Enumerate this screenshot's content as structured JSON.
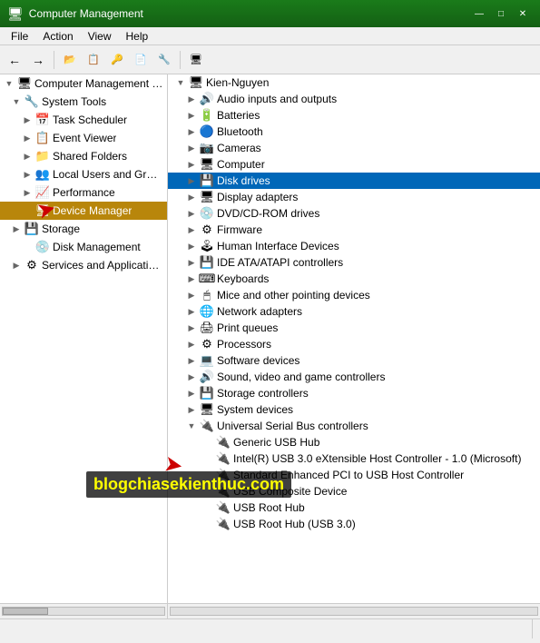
{
  "titlebar": {
    "title": "Computer Management",
    "icon": "🖥",
    "minimize_label": "—",
    "maximize_label": "□",
    "close_label": "✕"
  },
  "menubar": {
    "items": [
      {
        "label": "File"
      },
      {
        "label": "Action"
      },
      {
        "label": "View"
      },
      {
        "label": "Help"
      }
    ]
  },
  "toolbar": {
    "buttons": [
      "←",
      "→",
      "⬆",
      "✂",
      "📋",
      "📄",
      "✖",
      "🔧",
      "📊"
    ]
  },
  "left_panel": {
    "items": [
      {
        "id": "root",
        "label": "Computer Management (Local",
        "icon": "🖥",
        "indent": 0,
        "expand": "▼"
      },
      {
        "id": "system-tools",
        "label": "System Tools",
        "icon": "🔧",
        "indent": 1,
        "expand": "▼"
      },
      {
        "id": "task-scheduler",
        "label": "Task Scheduler",
        "icon": "📅",
        "indent": 2,
        "expand": "▶"
      },
      {
        "id": "event-viewer",
        "label": "Event Viewer",
        "icon": "📋",
        "indent": 2,
        "expand": "▶"
      },
      {
        "id": "shared-folders",
        "label": "Shared Folders",
        "icon": "📁",
        "indent": 2,
        "expand": "▶"
      },
      {
        "id": "local-users",
        "label": "Local Users and Groups",
        "icon": "👥",
        "indent": 2,
        "expand": "▶"
      },
      {
        "id": "performance",
        "label": "Performance",
        "icon": "📈",
        "indent": 2,
        "expand": "▶"
      },
      {
        "id": "device-manager",
        "label": "Device Manager",
        "icon": "🖥",
        "indent": 2,
        "expand": "",
        "selected": true
      },
      {
        "id": "storage",
        "label": "Storage",
        "icon": "💾",
        "indent": 1,
        "expand": "▶"
      },
      {
        "id": "disk-management",
        "label": "Disk Management",
        "icon": "💿",
        "indent": 2,
        "expand": ""
      },
      {
        "id": "services",
        "label": "Services and Applications",
        "icon": "⚙",
        "indent": 1,
        "expand": "▶"
      }
    ]
  },
  "right_panel": {
    "header": "Kien-Nguyen",
    "devices": [
      {
        "label": "Audio inputs and outputs",
        "icon": "🔊",
        "indent": 1,
        "expand": "▶"
      },
      {
        "label": "Batteries",
        "icon": "🔋",
        "indent": 1,
        "expand": "▶"
      },
      {
        "label": "Bluetooth",
        "icon": "🔵",
        "indent": 1,
        "expand": "▶"
      },
      {
        "label": "Cameras",
        "icon": "📷",
        "indent": 1,
        "expand": "▶"
      },
      {
        "label": "Computer",
        "icon": "🖥",
        "indent": 1,
        "expand": "▶"
      },
      {
        "label": "Disk drives",
        "icon": "💾",
        "indent": 1,
        "expand": "▶",
        "selected": true
      },
      {
        "label": "Display adapters",
        "icon": "🖥",
        "indent": 1,
        "expand": "▶"
      },
      {
        "label": "DVD/CD-ROM drives",
        "icon": "💿",
        "indent": 1,
        "expand": "▶"
      },
      {
        "label": "Firmware",
        "icon": "⚙",
        "indent": 1,
        "expand": "▶"
      },
      {
        "label": "Human Interface Devices",
        "icon": "🕹",
        "indent": 1,
        "expand": "▶"
      },
      {
        "label": "IDE ATA/ATAPI controllers",
        "icon": "💾",
        "indent": 1,
        "expand": "▶"
      },
      {
        "label": "Keyboards",
        "icon": "⌨",
        "indent": 1,
        "expand": "▶"
      },
      {
        "label": "Mice and other pointing devices",
        "icon": "🖱",
        "indent": 1,
        "expand": "▶"
      },
      {
        "label": "Network adapters",
        "icon": "🌐",
        "indent": 1,
        "expand": "▶"
      },
      {
        "label": "Print queues",
        "icon": "🖨",
        "indent": 1,
        "expand": "▶"
      },
      {
        "label": "Processors",
        "icon": "⚙",
        "indent": 1,
        "expand": "▶"
      },
      {
        "label": "Software devices",
        "icon": "💻",
        "indent": 1,
        "expand": "▶"
      },
      {
        "label": "Sound, video and game controllers",
        "icon": "🔊",
        "indent": 1,
        "expand": "▶"
      },
      {
        "label": "Storage controllers",
        "icon": "💾",
        "indent": 1,
        "expand": "▶"
      },
      {
        "label": "System devices",
        "icon": "🖥",
        "indent": 1,
        "expand": "▶"
      },
      {
        "label": "Universal Serial Bus controllers",
        "icon": "🔌",
        "indent": 1,
        "expand": "▼"
      },
      {
        "label": "Generic USB Hub",
        "icon": "🔌",
        "indent": 2,
        "expand": ""
      },
      {
        "label": "Intel(R) USB 3.0 eXtensible Host Controller - 1.0 (Microsoft)",
        "icon": "🔌",
        "indent": 2,
        "expand": ""
      },
      {
        "label": "Standard Enhanced PCI to USB Host Controller",
        "icon": "🔌",
        "indent": 2,
        "expand": ""
      },
      {
        "label": "USB Composite Device",
        "icon": "🔌",
        "indent": 2,
        "expand": ""
      },
      {
        "label": "USB Root Hub",
        "icon": "🔌",
        "indent": 2,
        "expand": ""
      },
      {
        "label": "USB Root Hub (USB 3.0)",
        "icon": "🔌",
        "indent": 2,
        "expand": ""
      }
    ]
  },
  "watermark": {
    "text": "blogchiasekienthuc.com"
  },
  "status": {
    "text": ""
  }
}
